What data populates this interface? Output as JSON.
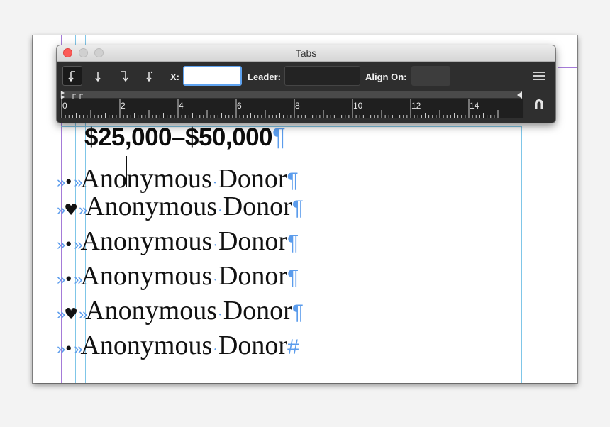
{
  "panel": {
    "title": "Tabs",
    "buttons": {
      "left": "left-justified-tab-icon",
      "center": "center-justified-tab-icon",
      "right": "right-justified-tab-icon",
      "decimal": "align-to-decimal-tab-icon",
      "menu": "panel-menu-icon",
      "snap": "position-panel-above-text-frame-icon"
    },
    "x_label": "X:",
    "x_value": "",
    "leader_label": "Leader:",
    "leader_value": "",
    "align_on_label": "Align On:",
    "align_on_value": "",
    "ruler_numbers": [
      "0",
      "2",
      "4",
      "6",
      "8",
      "10",
      "12",
      "14"
    ]
  },
  "document": {
    "heading": "$25,000–$50,000",
    "pilcrow": "¶",
    "end_of_story": "#",
    "tab_marker": "»",
    "space_dot": "·",
    "lines": [
      {
        "bullet": "•",
        "before_caret": "Ano",
        "after_caret": "nymous",
        "second_word": "Donor",
        "end": "¶"
      },
      {
        "bullet": "♥",
        "text_first": "Anonymous",
        "second_word": "Donor",
        "end": "¶"
      },
      {
        "bullet": "•",
        "text_first": "Anonymous",
        "second_word": "Donor",
        "end": "¶"
      },
      {
        "bullet": "•",
        "text_first": "Anonymous",
        "second_word": "Donor",
        "end": "¶"
      },
      {
        "bullet": "♥",
        "text_first": "Anonymous",
        "second_word": "Donor",
        "end": "¶"
      },
      {
        "bullet": "•",
        "text_first": "Anonymous",
        "second_word": "Donor",
        "end": "#"
      }
    ]
  },
  "colors": {
    "hidden_chars": "#5b9cec",
    "panel_bg": "#2f2f2f",
    "x_field_focus": "#5fa3f0",
    "close_button": "#fc5b57"
  }
}
